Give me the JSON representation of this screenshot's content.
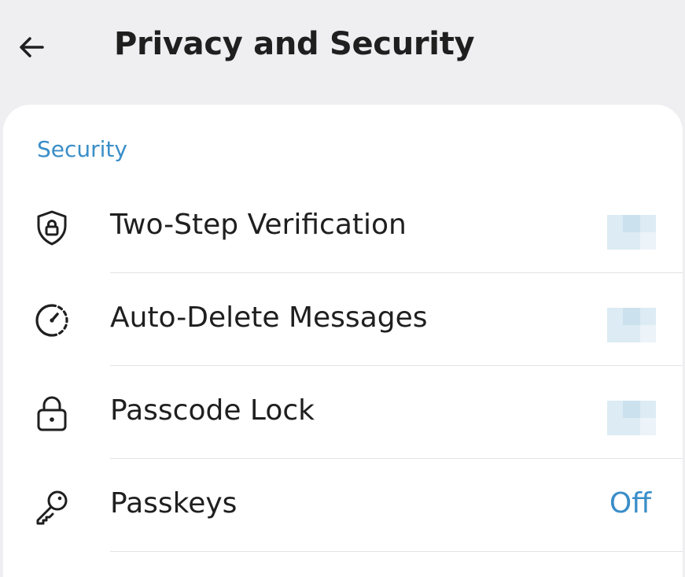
{
  "header": {
    "title": "Privacy and Security"
  },
  "security": {
    "section_title": "Security",
    "items": [
      {
        "label": "Two-Step Verification",
        "value": ""
      },
      {
        "label": "Auto-Delete Messages",
        "value": ""
      },
      {
        "label": "Passcode Lock",
        "value": ""
      },
      {
        "label": "Passkeys",
        "value": "Off"
      }
    ]
  },
  "colors": {
    "accent": "#3a8ec8",
    "background": "#efeff1",
    "card": "#ffffff",
    "text": "#1f1f1f"
  },
  "icons": [
    "back-arrow-icon",
    "shield-lock-icon",
    "timer-icon",
    "lock-icon",
    "key-icon"
  ]
}
